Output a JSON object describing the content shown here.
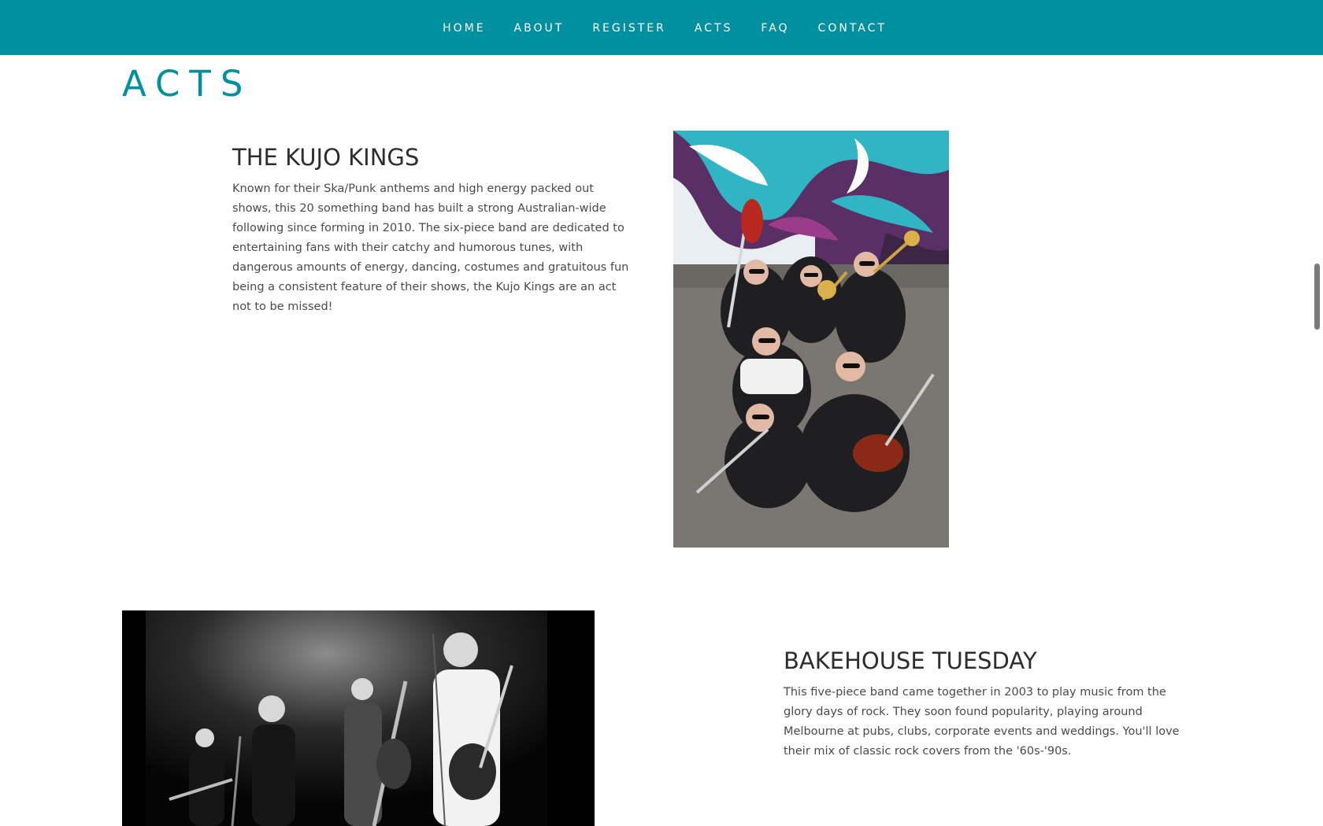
{
  "nav": {
    "items": [
      {
        "label": "HOME"
      },
      {
        "label": "ABOUT"
      },
      {
        "label": "REGISTER"
      },
      {
        "label": "ACTS"
      },
      {
        "label": "FAQ"
      },
      {
        "label": "CONTACT"
      }
    ]
  },
  "page": {
    "title": "ACTS"
  },
  "acts": [
    {
      "name": "THE KUJO KINGS",
      "description": "Known for their Ska/Punk anthems and high energy packed out shows, this 20 something band has built a strong Australian-wide following since forming in 2010. The six-piece band are dedicated to entertaining fans with their catchy and humorous tunes, with dangerous amounts of energy, dancing, costumes and gratuitous fun being a consistent feature of their shows, the Kujo Kings are an act not to be missed!"
    },
    {
      "name": "BAKEHOUSE TUESDAY",
      "description": "This five-piece band came together in 2003 to play music from the glory days of rock. They soon found popularity, playing around Melbourne at pubs, clubs, corporate events and weddings. You'll love their mix of classic rock covers from the '60s-'90s."
    }
  ],
  "colors": {
    "brand": "#0090a0",
    "heading": "#2d2d2d",
    "body_text": "#4a4a4a"
  }
}
